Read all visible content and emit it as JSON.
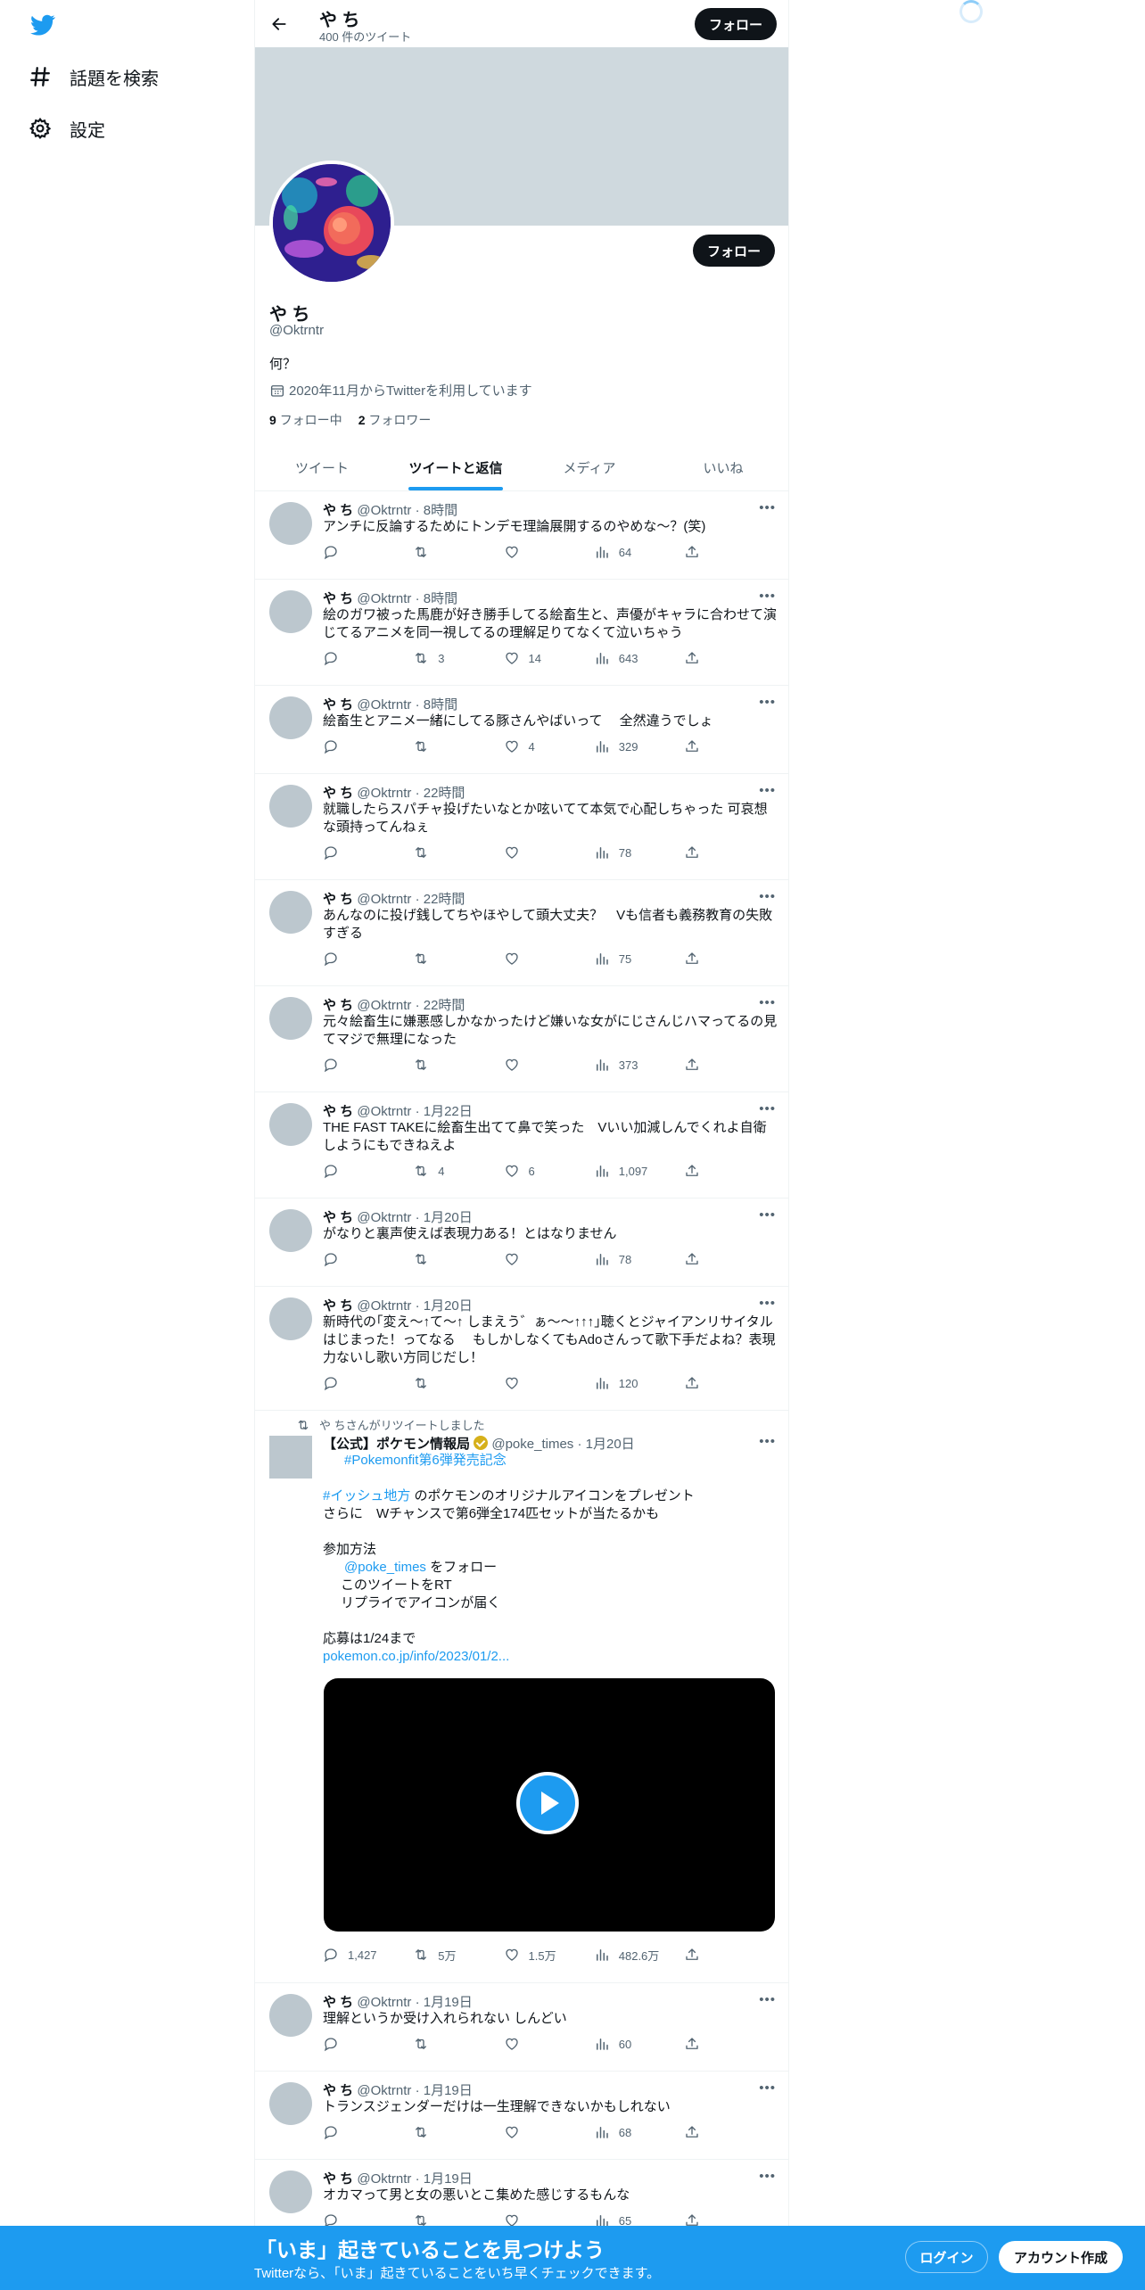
{
  "nav": {
    "explore": "話題を検索",
    "settings": "設定"
  },
  "header": {
    "name": "や ち",
    "tweet_count": "400 件のツイート",
    "follow": "フォロー"
  },
  "profile": {
    "name": "や ち",
    "handle": "@Oktrntr",
    "bio": "何？",
    "joined": "2020年11月からTwitterを利用しています",
    "following_count": "9",
    "following_label": "フォロー中",
    "followers_count": "2",
    "followers_label": "フォロワー",
    "follow": "フォロー"
  },
  "tabs": [
    "ツイート",
    "ツイートと返信",
    "メディア",
    "いいね"
  ],
  "tweets": [
    {
      "name": "や ち",
      "handle": "@Oktrntr",
      "time": "8時間",
      "text": "アンチに反論するためにトンデモ理論展開するのやめな～？(笑)",
      "replies": "",
      "retweets": "",
      "likes": "",
      "views": "64"
    },
    {
      "name": "や ち",
      "handle": "@Oktrntr",
      "time": "8時間",
      "text": "絵のガワ被った馬鹿が好き勝手してる絵畜生と、声優がキャラに合わせて演じてるアニメを同一視してるの理解足りてなくて泣いちゃう",
      "replies": "",
      "retweets": "3",
      "likes": "14",
      "views": "643"
    },
    {
      "name": "や ち",
      "handle": "@Oktrntr",
      "time": "8時間",
      "text": "絵畜生とアニメ一緒にしてる豚さんやばいって　 全然違うでしょ",
      "replies": "",
      "retweets": "",
      "likes": "4",
      "views": "329"
    },
    {
      "name": "や ち",
      "handle": "@Oktrntr",
      "time": "22時間",
      "text": "就職したらスパチャ投げたいなとか呟いてて本気で心配しちゃった 可哀想な頭持ってんねぇ",
      "replies": "",
      "retweets": "",
      "likes": "",
      "views": "78"
    },
    {
      "name": "や ち",
      "handle": "@Oktrntr",
      "time": "22時間",
      "text": "あんなのに投げ銭してちやほやして頭大丈夫？　Vも信者も義務教育の失敗すぎる",
      "replies": "",
      "retweets": "",
      "likes": "",
      "views": "75"
    },
    {
      "name": "や ち",
      "handle": "@Oktrntr",
      "time": "22時間",
      "text": "元々絵畜生に嫌悪感しかなかったけど嫌いな女がにじさんじハマってるの見てマジで無理になった",
      "replies": "",
      "retweets": "",
      "likes": "",
      "views": "373"
    },
    {
      "name": "や ち",
      "handle": "@Oktrntr",
      "time": "1月22日",
      "text": "THE FAST TAKEに絵畜生出てて鼻で笑った　Vいい加減しんでくれよ自衛しようにもできねえよ",
      "replies": "",
      "retweets": "4",
      "likes": "6",
      "views": "1,097"
    },
    {
      "name": "や ち",
      "handle": "@Oktrntr",
      "time": "1月20日",
      "text": "がなりと裏声使えば表現力ある！とはなりません",
      "replies": "",
      "retweets": "",
      "likes": "",
      "views": "78"
    },
    {
      "name": "や ち",
      "handle": "@Oktrntr",
      "time": "1月20日",
      "text": "新時代の｢変え～↑て～↑ しまえう゛ぁ～～↑↑↑｣聴くとジャイアンリサイタルはじまった！ってなる　 もしかしなくてもAdoさんって歌下手だよね？表現力ないし歌い方同じだし！",
      "replies": "",
      "retweets": "",
      "likes": "",
      "views": "120"
    }
  ],
  "retweet": {
    "label": "や ちさんがリツイートしました",
    "name": "【公式】ポケモン情報局",
    "handle": "@poke_times",
    "time": "1月20日",
    "hashtag": "#Pokemonfit第6弾発売記念",
    "line1_tag": "#イッシュ地方",
    "line1_rest": " のポケモンのオリジナルアイコンをプレゼント",
    "line2": "さらに　Wチャンスで第6弾全174匹セットが当たるかも",
    "method_title": "参加方法",
    "method_mention": "@poke_times",
    "method_mention_rest": " をフォロー",
    "method_2": "このツイートをRT",
    "method_3": "リプライでアイコンが届く",
    "deadline": "応募は1/24まで",
    "link": "pokemon.co.jp/info/2023/01/2...",
    "replies": "1,427",
    "retweets": "5万",
    "likes": "1.5万",
    "views": "482.6万"
  },
  "tweets2": [
    {
      "name": "や ち",
      "handle": "@Oktrntr",
      "time": "1月19日",
      "text": "理解というか受け入れられない しんどい",
      "replies": "",
      "retweets": "",
      "likes": "",
      "views": "60"
    },
    {
      "name": "や ち",
      "handle": "@Oktrntr",
      "time": "1月19日",
      "text": "トランスジェンダーだけは一生理解できないかもしれない",
      "replies": "",
      "retweets": "",
      "likes": "",
      "views": "68"
    },
    {
      "name": "や ち",
      "handle": "@Oktrntr",
      "time": "1月19日",
      "text": "オカマって男と女の悪いとこ集めた感じするもんな",
      "replies": "",
      "retweets": "",
      "likes": "",
      "views": "65"
    }
  ],
  "bottom_bar": {
    "title": "「いま」起きていることを見つけよう",
    "subtitle": "Twitterなら、「いま」起きていることをいち早くチェックできます。",
    "login": "ログイン",
    "signup": "アカウント作成"
  },
  "colors": {
    "accent": "#1d9bf0",
    "text": "#0f1419",
    "muted": "#536471",
    "banner": "#cfd9de"
  }
}
